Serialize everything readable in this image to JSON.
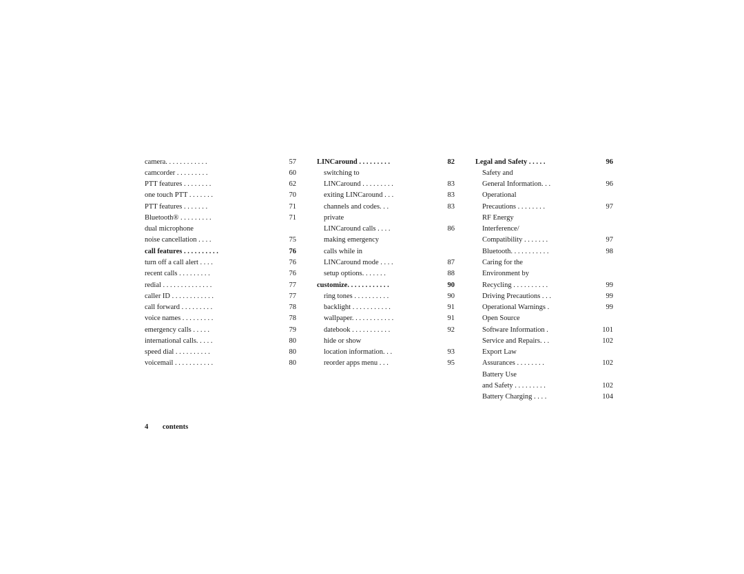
{
  "page": {
    "footer": {
      "number": "4",
      "label": "contents"
    }
  },
  "columns": [
    {
      "id": "col1",
      "entries": [
        {
          "text": "camera. . . . . . . . . . . .",
          "page": "57",
          "indent": false,
          "bold": false
        },
        {
          "text": "camcorder . . . . . . . . .",
          "page": "60",
          "indent": false,
          "bold": false
        },
        {
          "text": "PTT features . . . . . . . .",
          "page": "62",
          "indent": false,
          "bold": false
        },
        {
          "text": "one touch PTT . . . . . . .",
          "page": "70",
          "indent": false,
          "bold": false
        },
        {
          "text": "PTT features  . . . . . . .",
          "page": "71",
          "indent": false,
          "bold": false
        },
        {
          "text": "Bluetooth® . . . . . . . . .",
          "page": "71",
          "indent": false,
          "bold": false
        },
        {
          "text": "dual microphone",
          "page": "",
          "indent": false,
          "bold": false
        },
        {
          "text": "noise cancellation . . . .",
          "page": "75",
          "indent": false,
          "bold": false
        },
        {
          "text": "call features . . . . . . . . . .",
          "page": "76",
          "indent": false,
          "bold": true
        },
        {
          "text": "turn off a call alert . . . .",
          "page": "76",
          "indent": false,
          "bold": false
        },
        {
          "text": "recent calls . . . . . . . . .",
          "page": "76",
          "indent": false,
          "bold": false
        },
        {
          "text": "redial . . . . . . . . . . . . . .",
          "page": "77",
          "indent": false,
          "bold": false
        },
        {
          "text": "caller ID . . . . . . . . . . . .",
          "page": "77",
          "indent": false,
          "bold": false
        },
        {
          "text": "call forward . . . . . . . . .",
          "page": "78",
          "indent": false,
          "bold": false
        },
        {
          "text": "voice names . . . . . . . . .",
          "page": "78",
          "indent": false,
          "bold": false
        },
        {
          "text": "emergency calls . . . . .",
          "page": "79",
          "indent": false,
          "bold": false
        },
        {
          "text": "international calls. . . . .",
          "page": "80",
          "indent": false,
          "bold": false
        },
        {
          "text": "speed dial . . . . . . . . . .",
          "page": "80",
          "indent": false,
          "bold": false
        },
        {
          "text": "voicemail . . . . . . . . . . .",
          "page": "80",
          "indent": false,
          "bold": false
        }
      ]
    },
    {
      "id": "col2",
      "entries": [
        {
          "text": "LINCaround . . . . . . . . .",
          "page": "82",
          "indent": false,
          "bold": true
        },
        {
          "text": "switching to",
          "page": "",
          "indent": true,
          "bold": false
        },
        {
          "text": "LINCaround . . . . . . . . .",
          "page": "83",
          "indent": true,
          "bold": false
        },
        {
          "text": "exiting LINCaround . . .",
          "page": "83",
          "indent": true,
          "bold": false
        },
        {
          "text": "channels and codes. . .",
          "page": "83",
          "indent": true,
          "bold": false
        },
        {
          "text": "private",
          "page": "",
          "indent": true,
          "bold": false
        },
        {
          "text": "LINCaround calls . . . .",
          "page": "86",
          "indent": true,
          "bold": false
        },
        {
          "text": "making emergency",
          "page": "",
          "indent": true,
          "bold": false
        },
        {
          "text": "calls while in",
          "page": "",
          "indent": true,
          "bold": false
        },
        {
          "text": "LINCaround mode . . . .",
          "page": "87",
          "indent": true,
          "bold": false
        },
        {
          "text": "setup options. . . . . . .",
          "page": "88",
          "indent": true,
          "bold": false
        },
        {
          "text": "customize. . . . . . . . . . . .",
          "page": "90",
          "indent": false,
          "bold": true
        },
        {
          "text": "ring tones . . . . . . . . . .",
          "page": "90",
          "indent": true,
          "bold": false
        },
        {
          "text": "backlight  . . . . . . . . . . .",
          "page": "91",
          "indent": true,
          "bold": false
        },
        {
          "text": "wallpaper. . . . . . . . . . . .",
          "page": "91",
          "indent": true,
          "bold": false
        },
        {
          "text": "datebook . . . . . . . . . . .",
          "page": "92",
          "indent": true,
          "bold": false
        },
        {
          "text": "hide or show",
          "page": "",
          "indent": true,
          "bold": false
        },
        {
          "text": "location information. . .",
          "page": "93",
          "indent": true,
          "bold": false
        },
        {
          "text": "reorder apps menu . . .",
          "page": "95",
          "indent": true,
          "bold": false
        }
      ]
    },
    {
      "id": "col3",
      "entries": [
        {
          "text": "Legal and Safety . . . . .",
          "page": "96",
          "indent": false,
          "bold": true
        },
        {
          "text": "Safety and",
          "page": "",
          "indent": true,
          "bold": false
        },
        {
          "text": "General Information. . .",
          "page": "96",
          "indent": true,
          "bold": false
        },
        {
          "text": "Operational",
          "page": "",
          "indent": true,
          "bold": false
        },
        {
          "text": "Precautions . . . . . . . .",
          "page": "97",
          "indent": true,
          "bold": false
        },
        {
          "text": "RF Energy",
          "page": "",
          "indent": true,
          "bold": false
        },
        {
          "text": "Interference/",
          "page": "",
          "indent": true,
          "bold": false
        },
        {
          "text": "Compatibility . . . . . . .",
          "page": "97",
          "indent": true,
          "bold": false
        },
        {
          "text": "Bluetooth. . . . . . . . . . .",
          "page": "98",
          "indent": true,
          "bold": false
        },
        {
          "text": "Caring for the",
          "page": "",
          "indent": true,
          "bold": false
        },
        {
          "text": "Environment by",
          "page": "",
          "indent": true,
          "bold": false
        },
        {
          "text": "Recycling . . . . . . . . . .",
          "page": "99",
          "indent": true,
          "bold": false
        },
        {
          "text": "Driving Precautions . . .",
          "page": "99",
          "indent": true,
          "bold": false
        },
        {
          "text": "Operational Warnings .",
          "page": "99",
          "indent": true,
          "bold": false
        },
        {
          "text": "Open Source",
          "page": "",
          "indent": true,
          "bold": false
        },
        {
          "text": "Software Information .",
          "page": "101",
          "indent": true,
          "bold": false
        },
        {
          "text": "Service and Repairs. . .",
          "page": "102",
          "indent": true,
          "bold": false
        },
        {
          "text": "Export Law",
          "page": "",
          "indent": true,
          "bold": false
        },
        {
          "text": "Assurances . . . . . . . .",
          "page": "102",
          "indent": true,
          "bold": false
        },
        {
          "text": "Battery Use",
          "page": "",
          "indent": true,
          "bold": false
        },
        {
          "text": "and Safety . . . . . . . . .",
          "page": "102",
          "indent": true,
          "bold": false
        },
        {
          "text": "Battery Charging . . . .",
          "page": "104",
          "indent": true,
          "bold": false
        }
      ]
    }
  ]
}
